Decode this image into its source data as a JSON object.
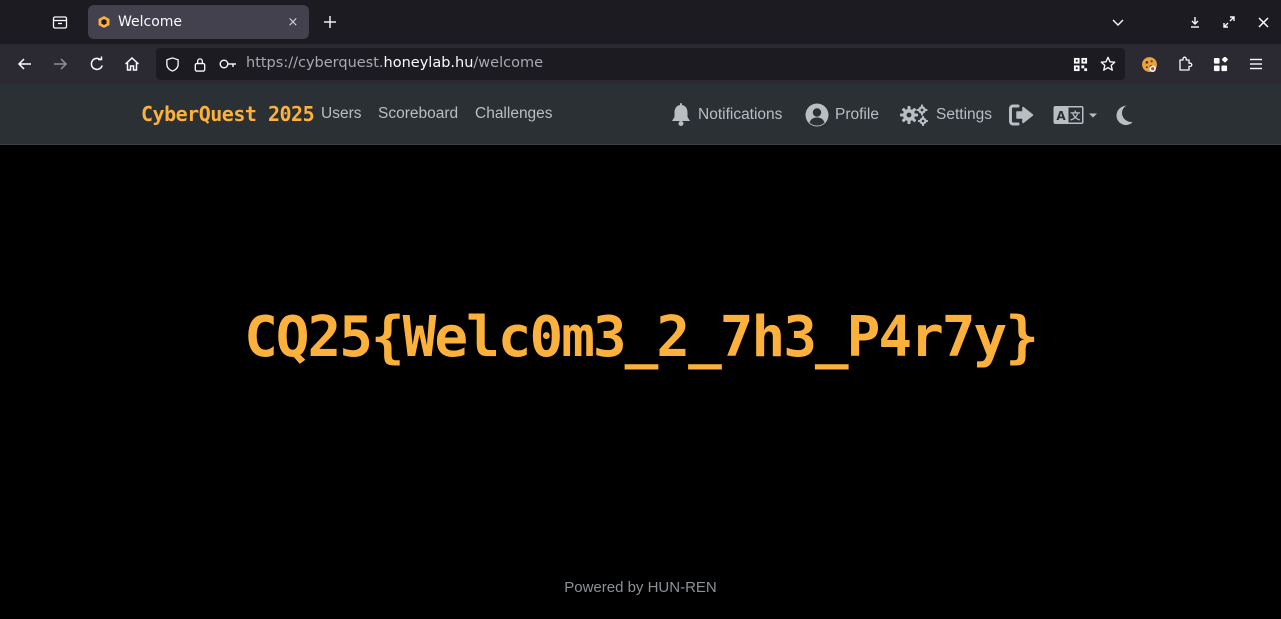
{
  "browser": {
    "tab_title": "Welcome",
    "tab_close": "×",
    "new_tab": "+",
    "url": {
      "scheme": "https://cyberquest.",
      "host": "honeylab.hu",
      "path": "/welcome"
    }
  },
  "site": {
    "brand": "CyberQuest 2025",
    "nav": {
      "users": "Users",
      "scoreboard": "Scoreboard",
      "challenges": "Challenges",
      "notifications": "Notifications",
      "profile": "Profile",
      "settings": "Settings"
    },
    "brand_color": "#fbb13c"
  },
  "main": {
    "flag": "CQ25{Welc0m3_2_7h3_P4r7y}",
    "footer": "Powered by HUN-REN"
  },
  "icons": {
    "tab": [
      "tab-list-icon",
      "favicon-hexagon-icon",
      "close-icon",
      "plus-icon",
      "chevron-down-icon",
      "download-icon",
      "fullscreen-icon",
      "window-close-icon"
    ],
    "toolbar": [
      "back-icon",
      "forward-icon",
      "reload-icon",
      "home-icon",
      "shield-icon",
      "lock-icon",
      "key-icon",
      "qr-code-icon",
      "bookmark-star-icon",
      "cookie-extension-icon",
      "puzzle-extensions-icon",
      "extensions-grid-icon",
      "hamburger-menu-icon"
    ],
    "site": [
      "bell-icon",
      "user-circle-icon",
      "gears-icon",
      "logout-icon",
      "language-icon",
      "caret-down-icon",
      "moon-icon"
    ]
  }
}
